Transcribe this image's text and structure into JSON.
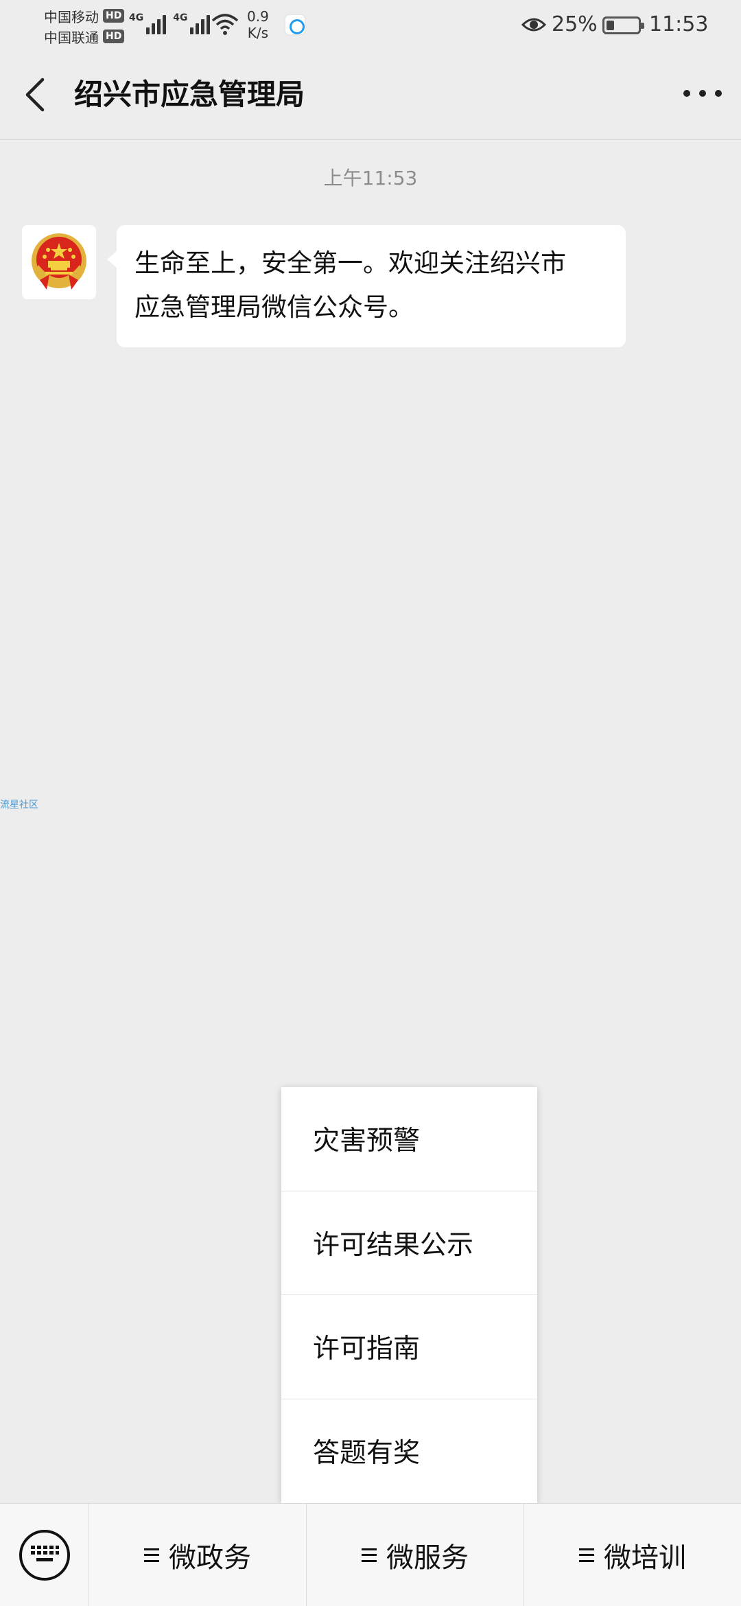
{
  "status_bar": {
    "carrier_1": "中国移动",
    "carrier_2": "中国联通",
    "hd_badge": "HD",
    "network_type": "4G",
    "speed_value": "0.9",
    "speed_unit": "K/s",
    "battery_percent": "25%",
    "battery_level": 0.25,
    "time": "11:53"
  },
  "nav": {
    "title": "绍兴市应急管理局",
    "back_icon": "chevron-left-icon",
    "more_icon": "more-dots-icon"
  },
  "chat": {
    "timestamp": "上午11:53",
    "message_line_1": "生命至上，安全第一。欢迎关注绍兴市",
    "message_line_2": "应急管理局微信公众号。",
    "watermark": "流星社区"
  },
  "popup_menu": {
    "items": [
      {
        "label": "灾害预警"
      },
      {
        "label": "许可结果公示"
      },
      {
        "label": "许可指南"
      },
      {
        "label": "答题有奖"
      }
    ]
  },
  "bottom_menu": {
    "keyboard_icon": "keyboard-icon",
    "tabs": [
      {
        "label": "微政务"
      },
      {
        "label": "微服务"
      },
      {
        "label": "微培训"
      }
    ]
  },
  "colors": {
    "background": "#ededed",
    "bubble": "#ffffff",
    "emblem_red": "#d8261c",
    "emblem_gold": "#e3b23c"
  }
}
